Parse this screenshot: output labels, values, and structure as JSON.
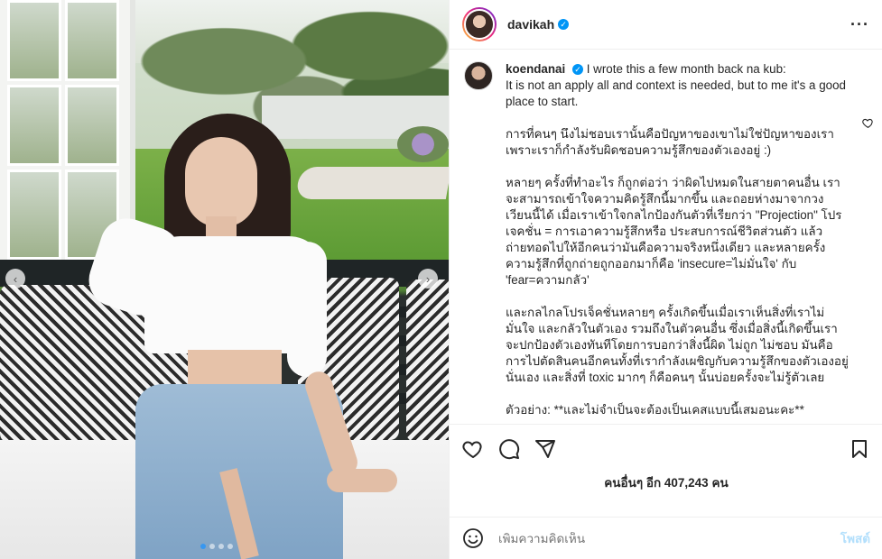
{
  "post": {
    "author": "davikah",
    "more_icon": "more-horizontal-icon",
    "verified_icon": "verified-badge-icon"
  },
  "caption": {
    "author": "koendanai",
    "paragraphs": [
      "I wrote this a few month back na kub:\nIt is not an apply all and context is needed, but to me it's a good place to start.",
      "การที่คนๆ นึงไม่ชอบเรานั้นคือปัญหาของเขาไม่ใช่ปัญหาของเรา เพราะเราก็กำลังรับผิดชอบความรู้สึกของตัวเองอยู่ :)",
      "หลายๆ ครั้งที่ทำอะไร ก็ถูกต่อว่า ว่าผิดไปหมดในสายตาคนอื่น เราจะสามารถเข้าใจความคิดรู้สึกนี้มากขึ้น และถอยห่างมาจากวงเวียนนี้ได้ เมื่อเราเข้าใจกลไกป้องกันตัวที่เรียกว่า \"Projection\" โปรเจคชั่น = การเอาความรู้สึกหรือ ประสบการณ์ชีวิตส่วนตัว แล้วถ่ายทอดไปให้อีกคนว่ามันคือความจริงหนึ่งเดียว และหลายครั้งความรู้สึกที่ถูกถ่ายถูกออกมาก็คือ 'insecure=ไม่มั่นใจ' กับ 'fear=ความกลัว'",
      "และกลไกลโปรเจ็คชั่นหลายๆ ครั้งเกิดขึ้นเมื่อเราเห็นสิ่งที่เราไม่มั่นใจ และกลัวในตัวเอง รวมถึงในตัวคนอื่น ซึ่งเมื่อสิ่งนี้เกิดขึ้นเราจะปกป้องตัวเองทันทีโดยการบอกว่าสิ่งนี้ผิด ไม่ถูก ไม่ชอบ มันคือการไปตัดสินคนอีกคนทั้งที่เรากำลังเผชิญกับความรู้สึกของตัวเองอยู่นั่นเอง และสิ่งที่ toxic มากๆ ก็คือคนๆ นั้นบ่อยครั้งจะไม่รู้ตัวเลย",
      "ตัวอย่าง: **และไม่จำเป็นจะต้องเป็นเคสแบบนี้เสมอนะคะ**"
    ]
  },
  "likes_text": "คนอื่นๆ อีก 407,243 คน",
  "comment": {
    "placeholder": "เพิ่มความคิดเห็น",
    "post_label": "โพสต์"
  },
  "colors": {
    "verified": "#0095f6",
    "post_disabled": "#b2dffc",
    "carousel_active": "#3797f0"
  },
  "carousel": {
    "current_index": 1,
    "total": 4
  }
}
